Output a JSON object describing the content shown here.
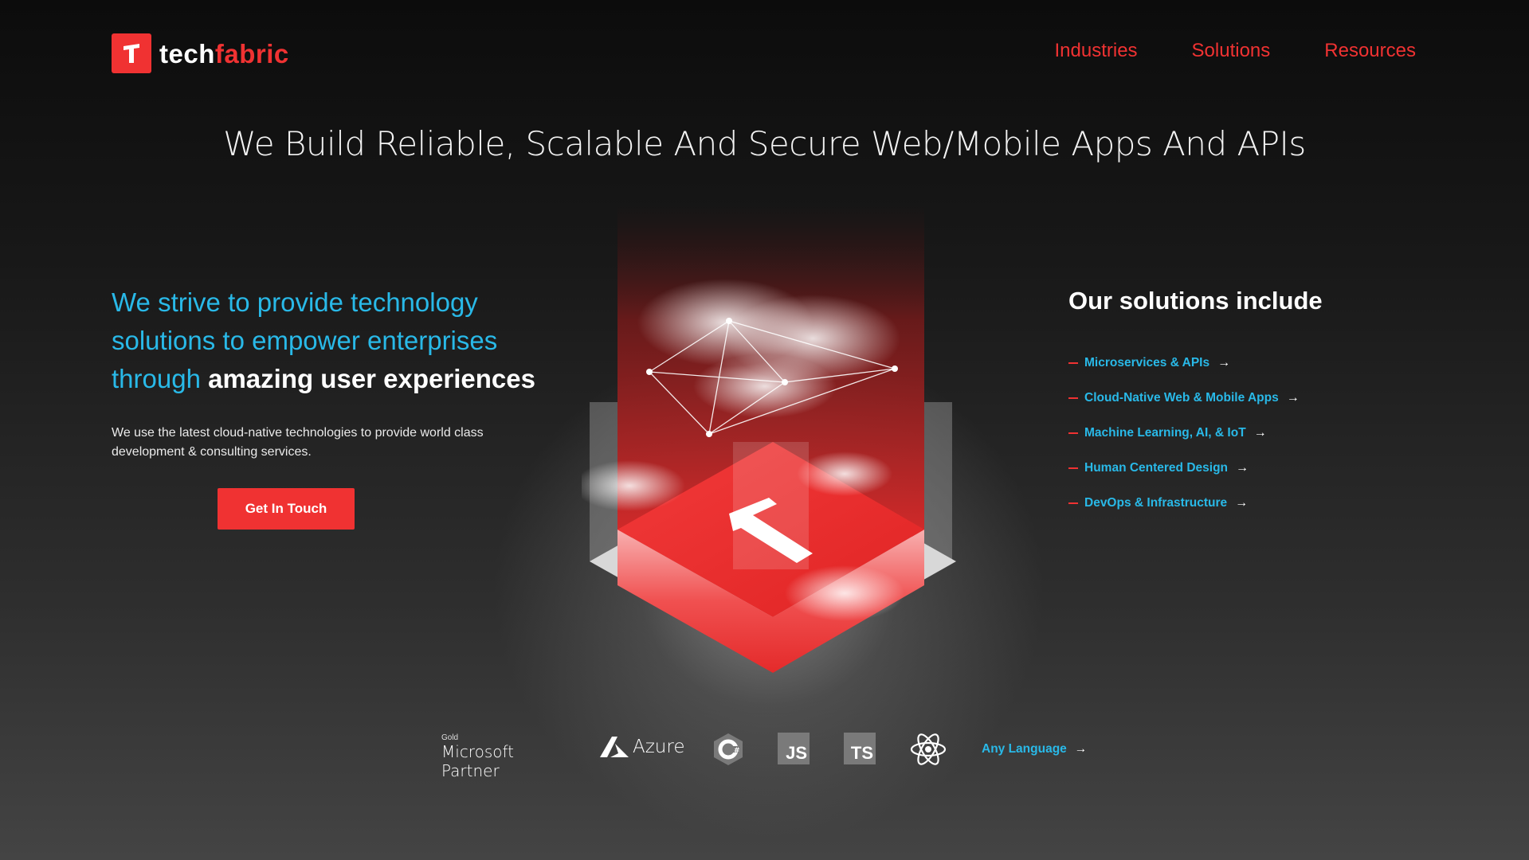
{
  "brand": {
    "name_part1": "tech",
    "name_part2": "fabric",
    "accent_color": "#f03232",
    "link_color": "#29b9e8"
  },
  "nav": {
    "items": [
      {
        "label": "Industries"
      },
      {
        "label": "Solutions"
      },
      {
        "label": "Resources"
      }
    ]
  },
  "hero": {
    "headline": "We Build Reliable, Scalable And Secure Web/Mobile Apps And APIs",
    "intro_line1": "We strive to provide technology",
    "intro_line2": "solutions to empower enterprises",
    "intro_line3": "through",
    "intro_bold": "amazing user experiences",
    "description": "We use the latest cloud-native technologies to provide world class development & consulting services.",
    "cta_label": "Get In Touch"
  },
  "solutions": {
    "title": "Our solutions include",
    "items": [
      {
        "label": "Microservices & APIs"
      },
      {
        "label": "Cloud-Native Web & Mobile Apps"
      },
      {
        "label": "Machine Learning, AI, & IoT"
      },
      {
        "label": "Human Centered Design"
      },
      {
        "label": "DevOps & Infrastructure"
      }
    ],
    "arrow": "→"
  },
  "partners": {
    "ms_gold": "Gold",
    "ms_name": "Microsoft Partner",
    "azure_name": "Azure",
    "js_label": "JS",
    "ts_label": "TS",
    "any_language": "Any Language",
    "arrow": "→"
  }
}
